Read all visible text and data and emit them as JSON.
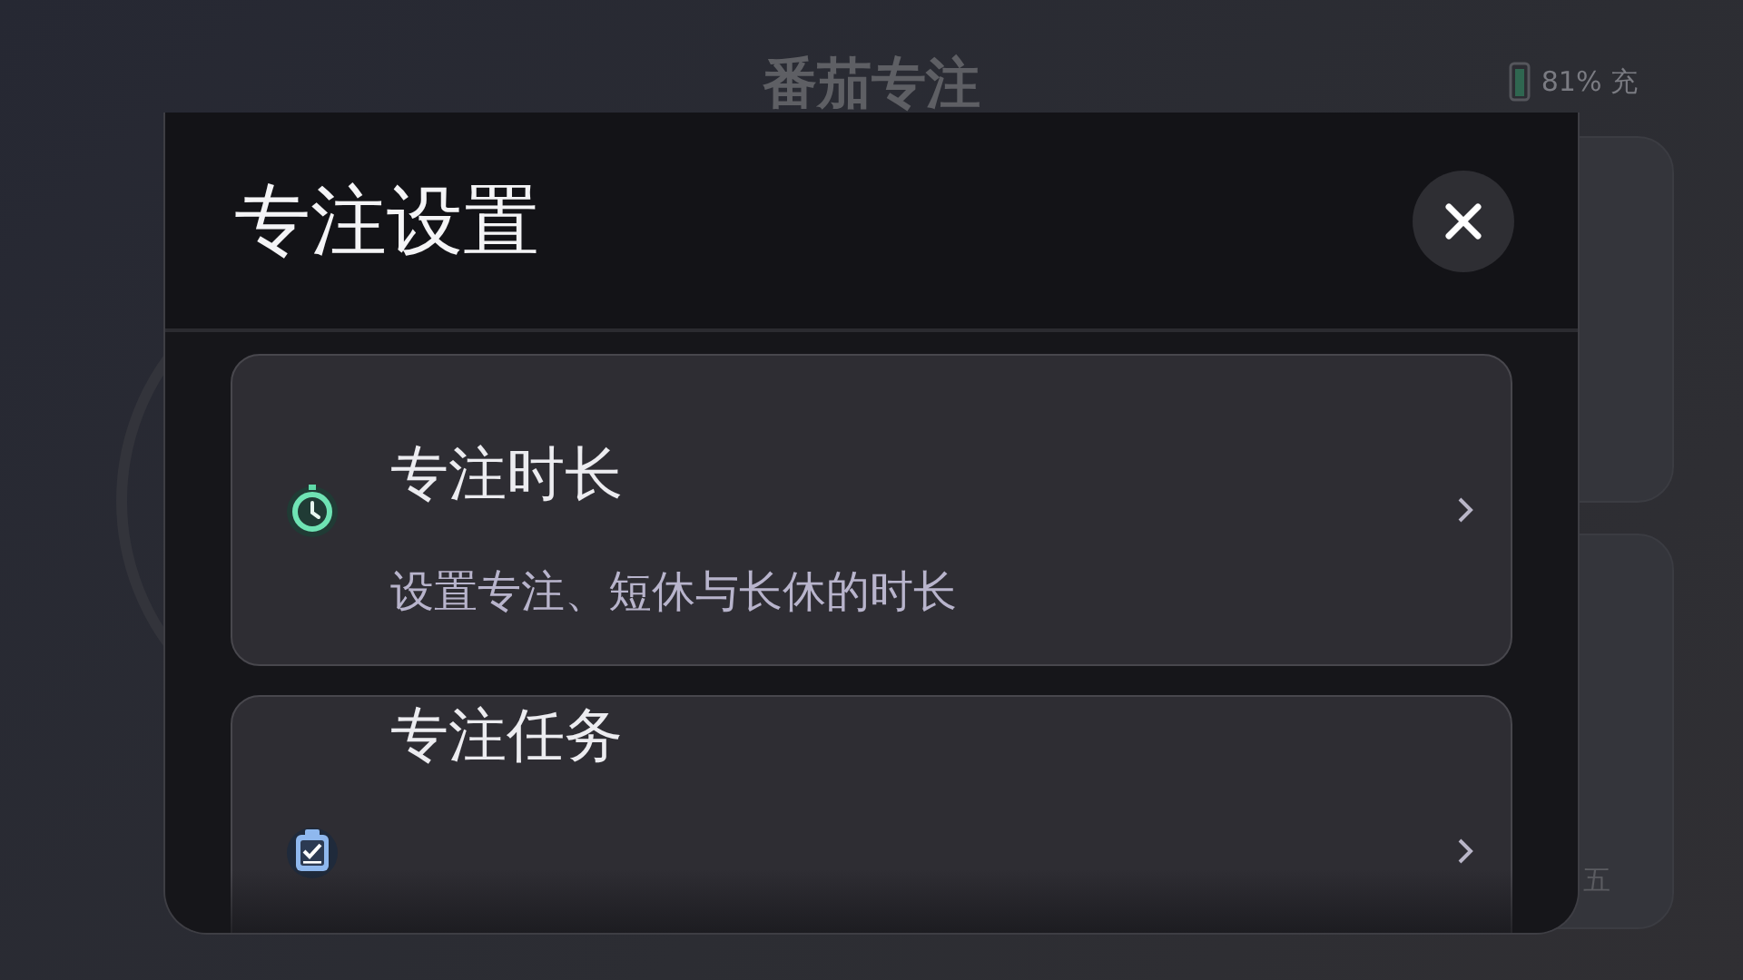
{
  "app": {
    "title": "番茄专注",
    "battery_text": "81% 充",
    "weekday_fragment": "五"
  },
  "dialog": {
    "title": "专注设置",
    "items": [
      {
        "kind": "timer",
        "title": "专注时长",
        "subtitle": "设置专注、短休与长休的时长"
      },
      {
        "kind": "task",
        "title": "专注任务"
      }
    ]
  }
}
